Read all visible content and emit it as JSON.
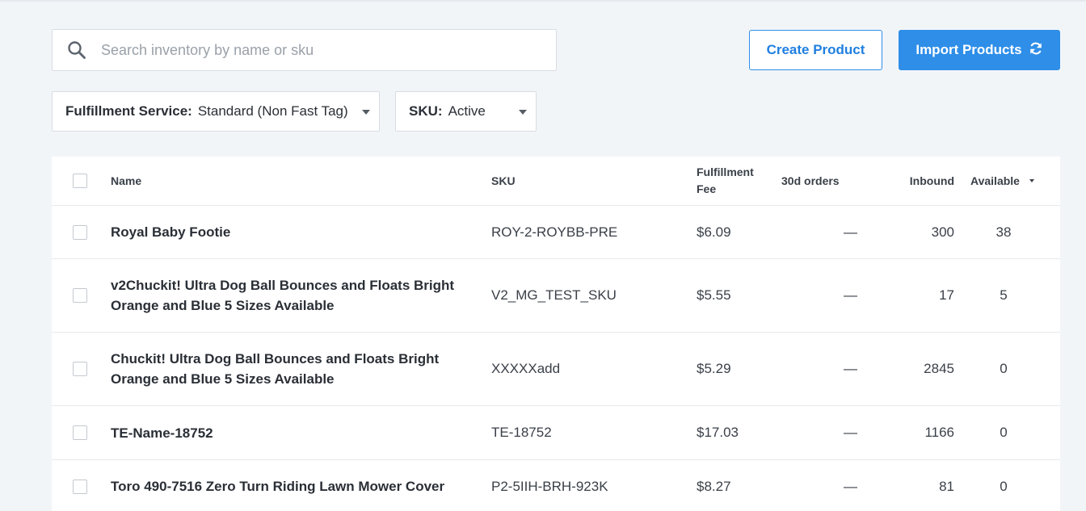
{
  "search": {
    "placeholder": "Search inventory by name or sku",
    "value": ""
  },
  "actions": {
    "create_label": "Create Product",
    "import_label": "Import Products",
    "import_icon": "refresh-icon"
  },
  "filters": {
    "fulfillment": {
      "label": "Fulfillment Service:",
      "value": "Standard (Non Fast Tag)"
    },
    "sku": {
      "label": "SKU:",
      "value": "Active"
    }
  },
  "table": {
    "columns": {
      "name": "Name",
      "sku": "SKU",
      "fee_line1": "Fulfillment",
      "fee_line2": "Fee",
      "orders": "30d orders",
      "inbound": "Inbound",
      "available": "Available"
    },
    "rows": [
      {
        "name": "Royal Baby Footie",
        "sku": "ROY-2-ROYBB-PRE",
        "fee": "$6.09",
        "orders": "—",
        "inbound": "300",
        "available": "38"
      },
      {
        "name": "v2Chuckit! Ultra Dog Ball Bounces and Floats Bright Orange and Blue 5 Sizes Available",
        "sku": "V2_MG_TEST_SKU",
        "fee": "$5.55",
        "orders": "—",
        "inbound": "17",
        "available": "5"
      },
      {
        "name": "Chuckit! Ultra Dog Ball Bounces and Floats Bright Orange and Blue 5 Sizes Available",
        "sku": "XXXXXadd",
        "fee": "$5.29",
        "orders": "—",
        "inbound": "2845",
        "available": "0"
      },
      {
        "name": "TE-Name-18752",
        "sku": "TE-18752",
        "fee": "$17.03",
        "orders": "—",
        "inbound": "1166",
        "available": "0"
      },
      {
        "name": "Toro 490-7516 Zero Turn Riding Lawn Mower Cover",
        "sku": "P2-5IIH-BRH-923K",
        "fee": "$8.27",
        "orders": "—",
        "inbound": "81",
        "available": "0"
      }
    ]
  }
}
